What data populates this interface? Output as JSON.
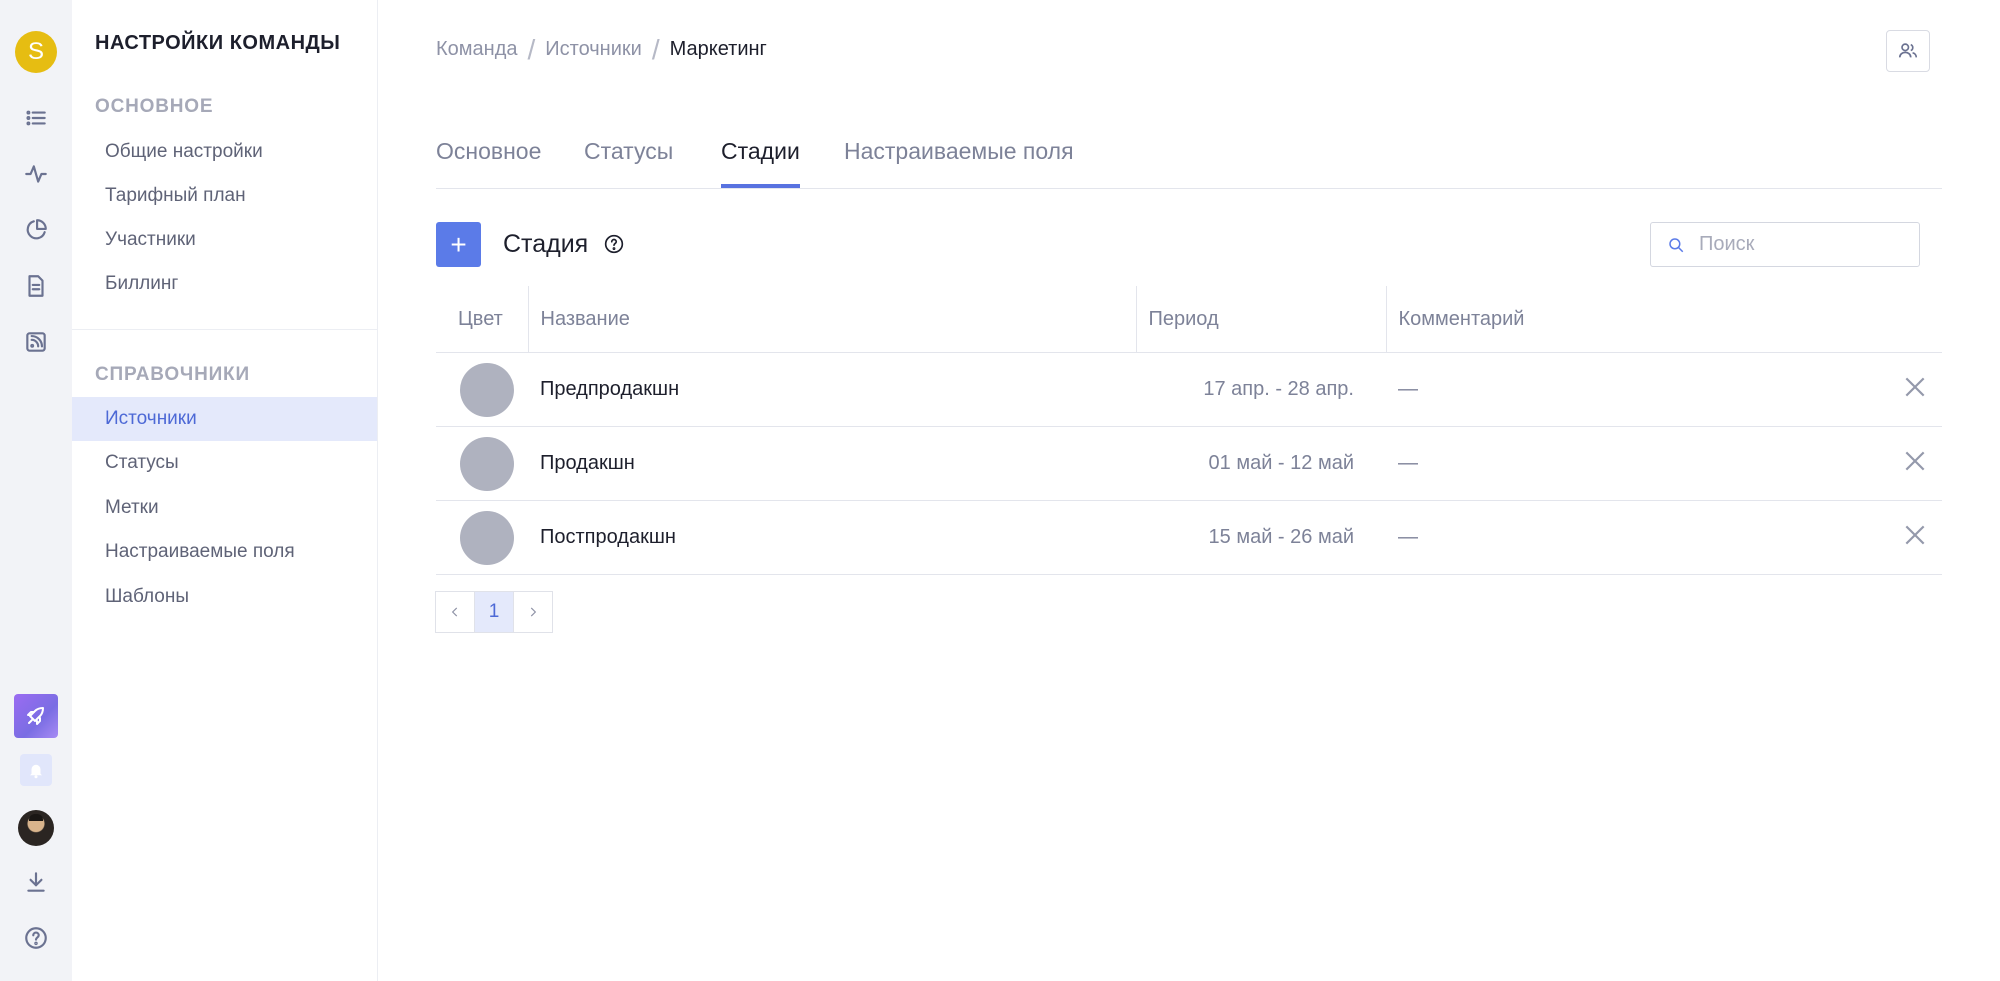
{
  "rail": {
    "team_initial": "S",
    "icons": [
      "list-icon",
      "activity-icon",
      "pie-chart-icon",
      "document-icon",
      "rss-icon"
    ],
    "bottom_icons": [
      "rocket-icon",
      "bell-icon",
      "user-avatar",
      "download-icon",
      "help-icon"
    ]
  },
  "settings": {
    "title": "НАСТРОЙКИ КОМАНДЫ",
    "main_section": "ОСНОВНОЕ",
    "main_items": [
      "Общие настройки",
      "Тарифный план",
      "Участники",
      "Биллинг"
    ],
    "ref_section": "СПРАВОЧНИКИ",
    "ref_items": [
      "Источники",
      "Статусы",
      "Метки",
      "Настраиваемые поля",
      "Шаблоны"
    ],
    "active_item": "Источники"
  },
  "breadcrumb": [
    "Команда",
    "Источники",
    "Маркетинг"
  ],
  "tabs": [
    "Основное",
    "Статусы",
    "Стадии",
    "Настраиваемые поля"
  ],
  "active_tab": "Стадии",
  "section": {
    "add_label": "+",
    "title": "Стадия",
    "search_placeholder": "Поиск"
  },
  "table": {
    "columns": [
      "Цвет",
      "Название",
      "Период",
      "Комментарий"
    ],
    "rows": [
      {
        "color": "#afb2bf",
        "name": "Предпродакшн",
        "period": "17 апр. - 28 апр.",
        "comment": "—"
      },
      {
        "color": "#afb2bf",
        "name": "Продакшн",
        "period": "01 май - 12 май",
        "comment": "—"
      },
      {
        "color": "#afb2bf",
        "name": "Постпродакшн",
        "period": "15 май - 26 май",
        "comment": "—"
      }
    ]
  },
  "pagination": {
    "current": "1"
  },
  "colors": {
    "accent": "#5b7be8",
    "active_bg": "#e4e9fb",
    "team_avatar": "#e6bd12"
  }
}
